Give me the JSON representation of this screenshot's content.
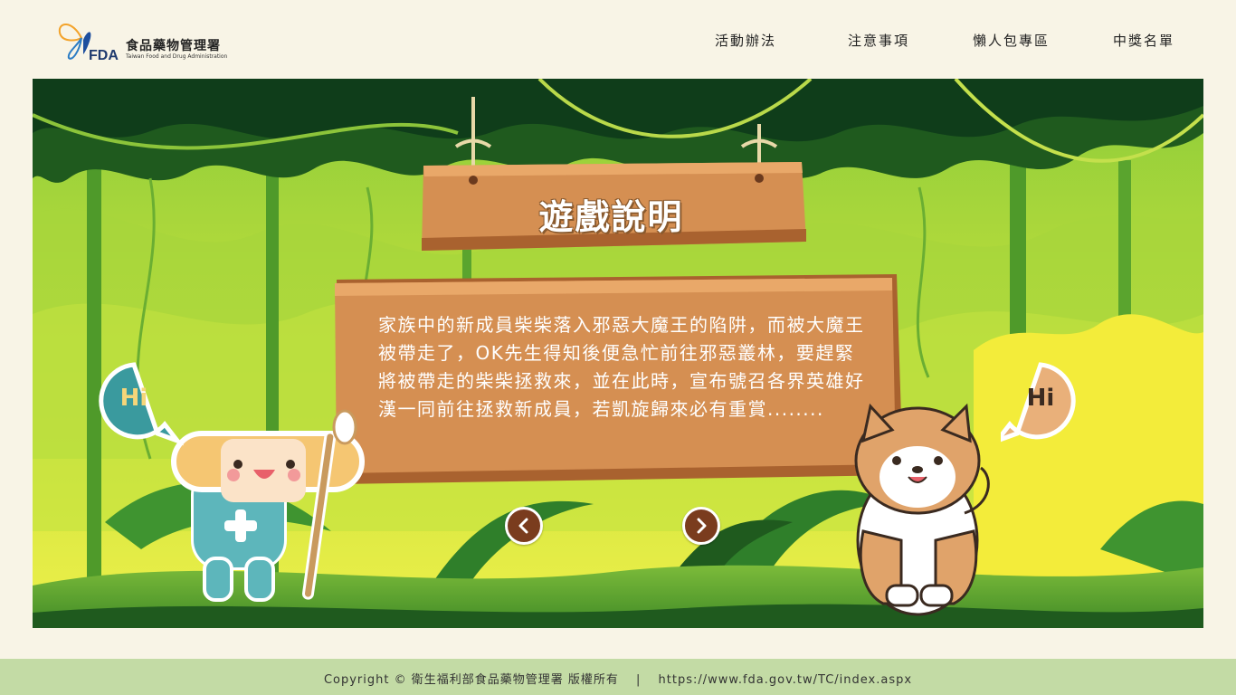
{
  "header": {
    "logo_mark": "FDA",
    "logo_cn": "食品藥物管理署",
    "logo_en": "Taiwan Food and Drug Administration",
    "nav": [
      "活動辦法",
      "注意事項",
      "懶人包專區",
      "中獎名單"
    ]
  },
  "stage": {
    "title": "遊戲說明",
    "description": "家族中的新成員柴柴落入邪惡大魔王的陷阱，而被大魔王被帶走了，OK先生得知後便急忙前往邪惡叢林，要趕緊將被帶走的柴柴拯救來，並在此時，宣布號召各界英雄好漢一同前往拯救新成員，若凱旋歸來必有重賞........",
    "bubble_left": "Hi",
    "bubble_right": "Hi",
    "prev_icon": "chevron-left-icon",
    "next_icon": "chevron-right-icon"
  },
  "footer": {
    "copyright": "Copyright © 衛生福利部食品藥物管理署 版權所有",
    "separator": "|",
    "url": "https://www.fda.gov.tw/TC/index.aspx"
  },
  "colors": {
    "page_bg": "#f8f4e6",
    "footer_bg": "#c3dba5",
    "jungle_dark": "#1f5a1e",
    "jungle_light": "#e9f04a",
    "wood": "#d58f52",
    "arrow_bg": "#7a3c1e"
  }
}
